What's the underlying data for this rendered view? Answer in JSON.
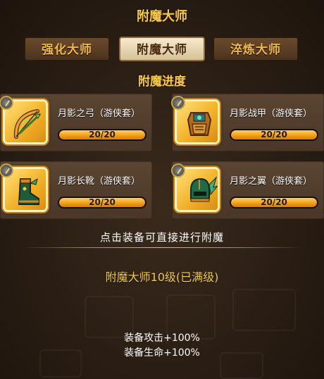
{
  "header": {
    "title": "附魔大师"
  },
  "tabs": [
    {
      "label": "强化大师",
      "active": false
    },
    {
      "label": "附魔大师",
      "active": true
    },
    {
      "label": "淬炼大师",
      "active": false
    }
  ],
  "progress_title": "附魔进度",
  "equipment": [
    {
      "name": "月影之弓（游侠套）",
      "progress_text": "20/20",
      "progress": 1.0,
      "icon": "bow-icon"
    },
    {
      "name": "月影战甲（游侠套）",
      "progress_text": "20/20",
      "progress": 1.0,
      "icon": "armor-icon"
    },
    {
      "name": "月影长靴（游侠套）",
      "progress_text": "20/20",
      "progress": 1.0,
      "icon": "boots-icon"
    },
    {
      "name": "月影之翼（游侠套）",
      "progress_text": "20/20",
      "progress": 1.0,
      "icon": "wing-helmet-icon"
    }
  ],
  "hint": "点击装备可直接进行附魔",
  "level_text": "附魔大师10级(已满级)",
  "bonuses": [
    "装备攻击+100%",
    "装备生命+100%"
  ],
  "colors": {
    "gold_text": "#f6c94c",
    "bar_fill": "#f29a1a",
    "slot_gold": "#f3b22a"
  }
}
